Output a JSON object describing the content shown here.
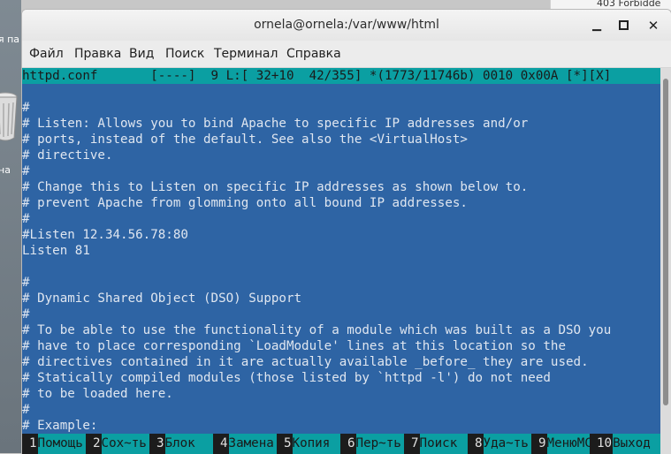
{
  "desktop": {
    "left_label_1": "я па",
    "left_label_2": "на",
    "bg_tab_label": "403 Forbidde"
  },
  "window": {
    "title": "ornela@ornela:/var/www/html",
    "minimize_glyph": "▁",
    "close_glyph": "✕"
  },
  "menu": {
    "file": "Файл",
    "edit": "Правка",
    "view": "Вид",
    "search": "Поиск",
    "terminal": "Терминал",
    "help": "Справка"
  },
  "editor": {
    "status_line": "httpd.conf       [----]  9 L:[ 32+10  42/355] *(1773/11746b) 0010 0x00A [*][X]",
    "lines": [
      "#",
      "# Listen: Allows you to bind Apache to specific IP addresses and/or",
      "# ports, instead of the default. See also the <VirtualHost>",
      "# directive.",
      "#",
      "# Change this to Listen on specific IP addresses as shown below to.",
      "# prevent Apache from glomming onto all bound IP addresses.",
      "#",
      "#Listen 12.34.56.78:80",
      "Listen 81",
      "",
      "#",
      "# Dynamic Shared Object (DSO) Support",
      "#",
      "# To be able to use the functionality of a module which was built as a DSO you",
      "# have to place corresponding `LoadModule' lines at this location so the",
      "# directives contained in it are actually available _before_ they are used.",
      "# Statically compiled modules (those listed by `httpd -l') do not need",
      "# to be loaded here.",
      "#",
      "# Example:"
    ]
  },
  "fkeys": [
    {
      "num": "1",
      "label": "Помощь"
    },
    {
      "num": "2",
      "label": "Сох~ть"
    },
    {
      "num": "3",
      "label": "Блок"
    },
    {
      "num": "4",
      "label": "Замена"
    },
    {
      "num": "5",
      "label": "Копия"
    },
    {
      "num": "6",
      "label": "Пер~ть"
    },
    {
      "num": "7",
      "label": "Поиск"
    },
    {
      "num": "8",
      "label": "Уда~ть"
    },
    {
      "num": "9",
      "label": "МенюМС"
    },
    {
      "num": "10",
      "label": "Выход"
    }
  ]
}
